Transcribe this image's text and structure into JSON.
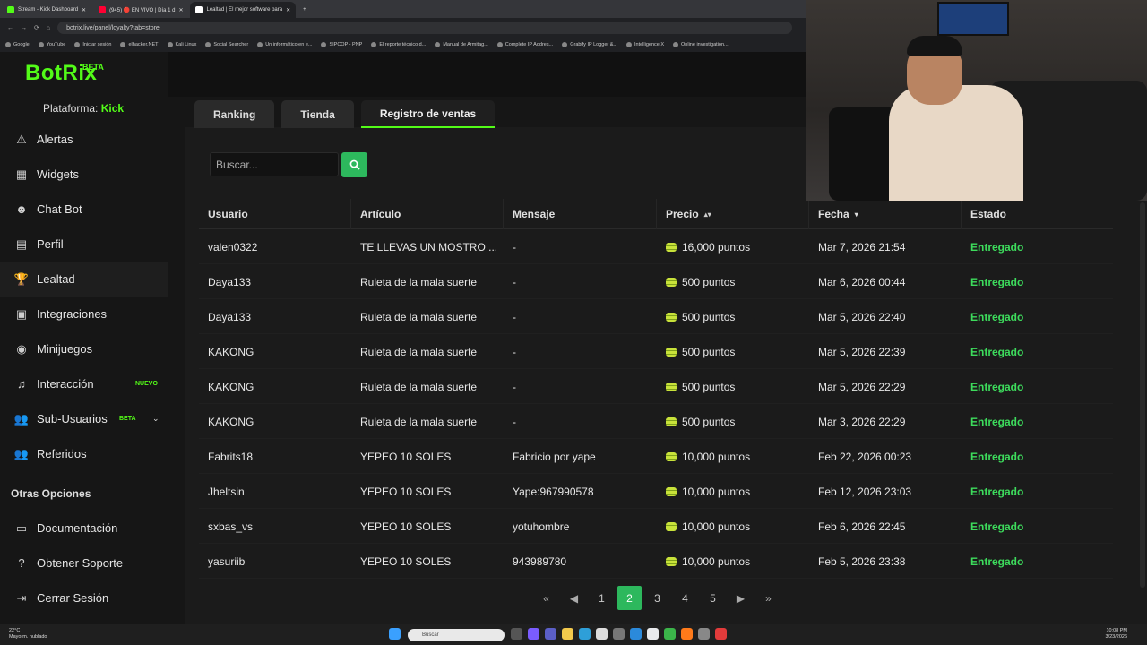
{
  "browser": {
    "tabs": [
      {
        "label": "Stream - Kick Dashboard",
        "color": "#53fc18"
      },
      {
        "label": "(945) 🔴 EN VIVO | Día 1 d",
        "color": "#ff0033"
      },
      {
        "label": "Lealtad | El mejor software para",
        "color": "#ffffff"
      }
    ],
    "url": "botrix.live/panel/loyalty?tab=store",
    "bookmarks": [
      "Google",
      "YouTube",
      "Iniciar sesión",
      "elhacker.NET",
      "Kali Linux",
      "Social Searcher",
      "Un informático en e...",
      "SIPCOP - PNP",
      "El reporte técnico d...",
      "Manual de Armitag...",
      "Complete IP Addres...",
      "Grabify IP Logger &...",
      "Intelligence X",
      "Online investigation..."
    ]
  },
  "app": {
    "logo": "BotRix",
    "logo_badge": "BETA",
    "platform_label": "Plataforma:",
    "platform_value": "Kick",
    "accent": "#53fc18",
    "nav": [
      {
        "label": "Alertas",
        "icon": "warning-icon",
        "glyph": "⚠"
      },
      {
        "label": "Widgets",
        "icon": "widgets-icon",
        "glyph": "▦"
      },
      {
        "label": "Chat Bot",
        "icon": "robot-icon",
        "glyph": "☻"
      },
      {
        "label": "Perfil",
        "icon": "profile-card-icon",
        "glyph": "▤"
      },
      {
        "label": "Lealtad",
        "icon": "trophy-icon",
        "glyph": "🏆"
      },
      {
        "label": "Integraciones",
        "icon": "integrations-icon",
        "glyph": "▣"
      },
      {
        "label": "Minijuegos",
        "icon": "gamepad-icon",
        "glyph": "◉"
      },
      {
        "label": "Interacción",
        "icon": "music-icon",
        "glyph": "♫"
      },
      {
        "label": "Sub-Usuarios",
        "icon": "users-icon",
        "glyph": "👥"
      },
      {
        "label": "Referidos",
        "icon": "referrals-icon",
        "glyph": "👥"
      }
    ],
    "nav_badges": {
      "nuevo": "NUEVO",
      "beta": "BETA"
    },
    "other_title": "Otras Opciones",
    "other_nav": [
      {
        "label": "Documentación",
        "icon": "book-icon",
        "glyph": "▭"
      },
      {
        "label": "Obtener Soporte",
        "icon": "help-icon",
        "glyph": "?"
      },
      {
        "label": "Cerrar Sesión",
        "icon": "logout-icon",
        "glyph": "⇥"
      }
    ],
    "tabs": [
      "Ranking",
      "Tienda",
      "Registro de ventas"
    ],
    "search_placeholder": "Buscar...",
    "columns": [
      "Usuario",
      "Artículo",
      "Mensaje",
      "Precio",
      "Fecha",
      "Estado"
    ],
    "rows": [
      [
        "valen0322",
        "TE LLEVAS UN MOSTRO ...",
        "-",
        "16,000 puntos",
        "Mar 7, 2026 21:54",
        "Entregado"
      ],
      [
        "Daya133",
        "Ruleta de la mala suerte",
        "-",
        "500 puntos",
        "Mar 6, 2026 00:44",
        "Entregado"
      ],
      [
        "Daya133",
        "Ruleta de la mala suerte",
        "-",
        "500 puntos",
        "Mar 5, 2026 22:40",
        "Entregado"
      ],
      [
        "KAKONG",
        "Ruleta de la mala suerte",
        "-",
        "500 puntos",
        "Mar 5, 2026 22:39",
        "Entregado"
      ],
      [
        "KAKONG",
        "Ruleta de la mala suerte",
        "-",
        "500 puntos",
        "Mar 5, 2026 22:29",
        "Entregado"
      ],
      [
        "KAKONG",
        "Ruleta de la mala suerte",
        "-",
        "500 puntos",
        "Mar 3, 2026 22:29",
        "Entregado"
      ],
      [
        "Fabrits18",
        "YEPEO 10 SOLES",
        "Fabricio por yape",
        "10,000 puntos",
        "Feb 22, 2026 00:23",
        "Entregado"
      ],
      [
        "Jheltsin",
        "YEPEO 10 SOLES",
        "Yape:967990578",
        "10,000 puntos",
        "Feb 12, 2026 23:03",
        "Entregado"
      ],
      [
        "sxbas_vs",
        "YEPEO 10 SOLES",
        "yotuhombre",
        "10,000 puntos",
        "Feb 6, 2026 22:45",
        "Entregado"
      ],
      [
        "yasuriib",
        "YEPEO 10 SOLES",
        "943989780",
        "10,000 puntos",
        "Feb 5, 2026 23:38",
        "Entregado"
      ]
    ],
    "pagination": [
      "1",
      "2",
      "3",
      "4",
      "5"
    ],
    "current_page": "2"
  },
  "taskbar": {
    "temp": "22°C",
    "weather": "Mayorm. nublado",
    "search": "Buscar",
    "time": "10:08 PM",
    "date": "3/23/2026"
  }
}
